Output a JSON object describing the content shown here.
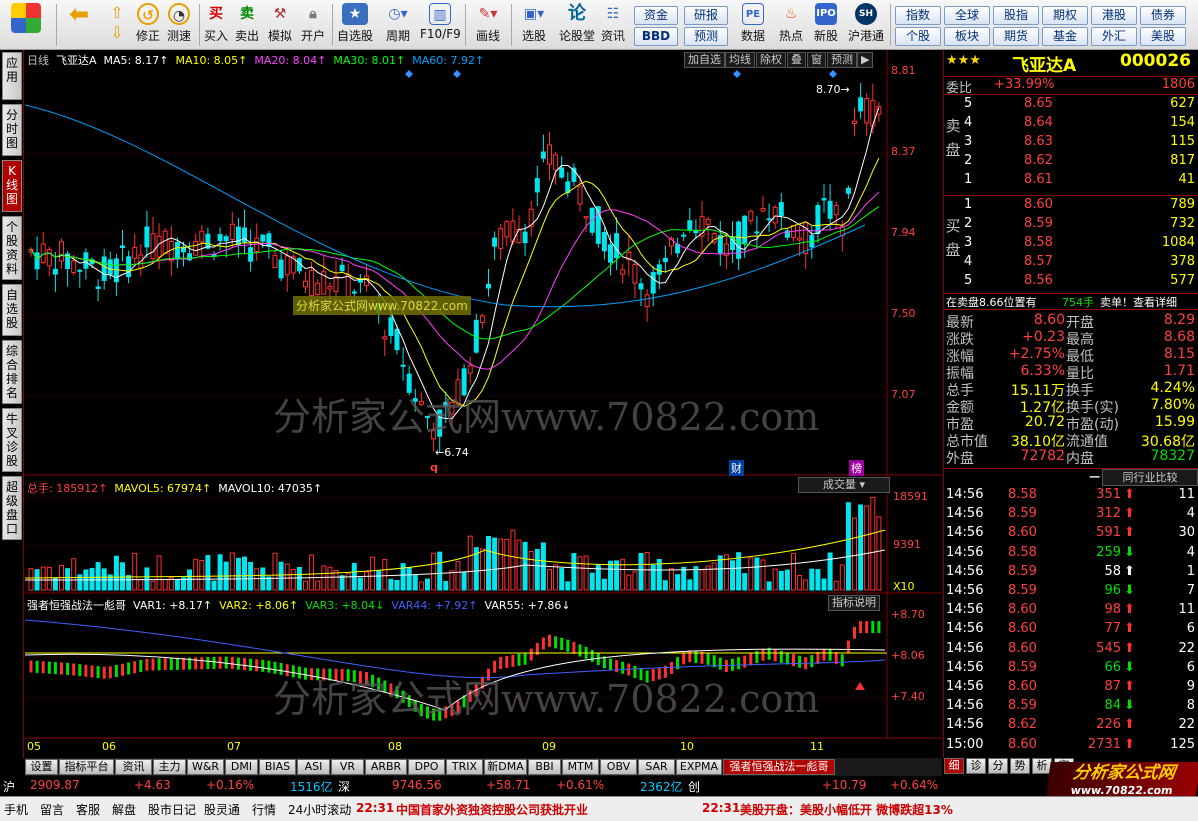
{
  "toolbar": {
    "buttons": [
      "修正",
      "测速",
      "买入",
      "卖出",
      "模拟",
      "开户",
      "自选股",
      "周期",
      "F10/F9",
      "画线",
      "选股",
      "论股堂",
      "资讯",
      "数据",
      "热点",
      "新股",
      "沪港通"
    ],
    "blue1": [
      "资金",
      "研报",
      "BBD",
      "预测"
    ],
    "blue2": [
      "指数",
      "全球",
      "股指",
      "期权",
      "港股",
      "债券",
      "个股",
      "板块",
      "期货",
      "基金",
      "外汇",
      "美股"
    ],
    "icon_glyphs": {
      "buy": "买",
      "sell": "卖",
      "lun": "论"
    }
  },
  "lefttabs": [
    "应用",
    "分时图",
    "K线图",
    "个股资料",
    "自选股",
    "综合排名",
    "牛叉诊股",
    "超级盘口"
  ],
  "kline": {
    "header": {
      "period": "日线",
      "name": "飞亚达A",
      "ma5": "MA5: 8.17↑",
      "ma10": "MA10: 8.05↑",
      "ma20": "MA20: 8.04↑",
      "ma30": "MA30: 8.01↑",
      "ma60": "MA60: 7.92↑"
    },
    "buttons": [
      "加自选",
      "均线",
      "除权",
      "叠",
      "窗",
      "预测",
      "▶"
    ],
    "yticks": [
      "8.81",
      "8.37",
      "7.94",
      "7.50",
      "7.07"
    ],
    "high_label": "8.70",
    "low_label": "6.74",
    "markers": [
      "q",
      "财",
      "榜"
    ],
    "watermark": "分析家公式网www.70822.com",
    "watermark_box": "分析家公式网www.70822.com"
  },
  "volume": {
    "header": {
      "total": "总手: 185912↑",
      "mavol5": "MAVOL5: 67974↑",
      "mavol10": "MAVOL10: 47035↑"
    },
    "selector": "成交量",
    "yticks": [
      "18591",
      "9391"
    ],
    "unit": "X10"
  },
  "indicator": {
    "header": {
      "name": "强者恒强战法一彪哥",
      "var1": "VAR1: +8.17↑",
      "var2": "VAR2: +8.06↑",
      "var3": "VAR3: +8.04↓",
      "var44": "VAR44: +7.92↑",
      "var55": "VAR55: +7.86↓"
    },
    "button": "指标说明",
    "yticks": [
      "+8.70",
      "+8.06",
      "+7.40"
    ]
  },
  "xaxis": [
    "05",
    "06",
    "07",
    "08",
    "09",
    "10",
    "11"
  ],
  "bottom_tabs": [
    "设置",
    "指标平台",
    "资讯",
    "主力",
    "W&R",
    "DMI",
    "BIAS",
    "ASI",
    "VR",
    "ARBR",
    "DPO",
    "TRIX",
    "新DMA",
    "BBI",
    "MTM",
    "OBV",
    "SAR",
    "EXPMA",
    "强者恒强战法一彪哥"
  ],
  "quote": {
    "stars": "★★★",
    "name": "飞亚达A",
    "code": "000026",
    "weibi_label": "委比",
    "weibi": "+33.99%",
    "weicha": "1806",
    "sell_label": "卖盘",
    "buy_label": "买盘",
    "sell": [
      {
        "n": "5",
        "p": "8.65",
        "v": "627"
      },
      {
        "n": "4",
        "p": "8.64",
        "v": "154"
      },
      {
        "n": "3",
        "p": "8.63",
        "v": "115"
      },
      {
        "n": "2",
        "p": "8.62",
        "v": "817"
      },
      {
        "n": "1",
        "p": "8.61",
        "v": "41"
      }
    ],
    "buy": [
      {
        "n": "1",
        "p": "8.60",
        "v": "789"
      },
      {
        "n": "2",
        "p": "8.59",
        "v": "732"
      },
      {
        "n": "3",
        "p": "8.58",
        "v": "1084"
      },
      {
        "n": "4",
        "p": "8.57",
        "v": "378"
      },
      {
        "n": "5",
        "p": "8.56",
        "v": "577"
      }
    ],
    "info": "在卖盘8.66位置有",
    "info_vol": "754手",
    "info_tail": "卖单！查看详细",
    "stats": [
      {
        "l1": "最新",
        "v1": "8.60",
        "l2": "开盘",
        "v2": "8.29"
      },
      {
        "l1": "涨跌",
        "v1": "+0.23",
        "l2": "最高",
        "v2": "8.68"
      },
      {
        "l1": "涨幅",
        "v1": "+2.75%",
        "l2": "最低",
        "v2": "8.15"
      },
      {
        "l1": "振幅",
        "v1": "6.33%",
        "l2": "量比",
        "v2": "1.71"
      },
      {
        "l1": "总手",
        "v1": "15.11万",
        "l2": "换手",
        "v2": "4.24%"
      },
      {
        "l1": "金额",
        "v1": "1.27亿",
        "l2": "换手(实)",
        "v2": "7.80%"
      },
      {
        "l1": "市盈",
        "v1": "20.72",
        "l2": "市盈(动)",
        "v2": "15.99"
      },
      {
        "l1": "总市值",
        "v1": "38.10亿",
        "l2": "流通值",
        "v2": "30.68亿"
      },
      {
        "l1": "外盘",
        "v1": "72782",
        "l2": "内盘",
        "v2": "78327"
      }
    ],
    "compare_btn": "同行业比较",
    "minus": "−",
    "ticks": [
      {
        "t": "14:56",
        "p": "8.58",
        "v": "351",
        "d": "up",
        "n": "11"
      },
      {
        "t": "14:56",
        "p": "8.59",
        "v": "312",
        "d": "up",
        "n": "4"
      },
      {
        "t": "14:56",
        "p": "8.60",
        "v": "591",
        "d": "up",
        "n": "30"
      },
      {
        "t": "14:56",
        "p": "8.58",
        "v": "259",
        "d": "down",
        "n": "4"
      },
      {
        "t": "14:56",
        "p": "8.59",
        "v": "58",
        "d": "upw",
        "n": "1"
      },
      {
        "t": "14:56",
        "p": "8.59",
        "v": "96",
        "d": "down",
        "n": "7"
      },
      {
        "t": "14:56",
        "p": "8.60",
        "v": "98",
        "d": "up",
        "n": "11"
      },
      {
        "t": "14:56",
        "p": "8.60",
        "v": "77",
        "d": "up",
        "n": "6"
      },
      {
        "t": "14:56",
        "p": "8.60",
        "v": "545",
        "d": "up",
        "n": "22"
      },
      {
        "t": "14:56",
        "p": "8.59",
        "v": "66",
        "d": "down",
        "n": "6"
      },
      {
        "t": "14:56",
        "p": "8.60",
        "v": "87",
        "d": "up",
        "n": "9"
      },
      {
        "t": "14:56",
        "p": "8.59",
        "v": "84",
        "d": "down",
        "n": "8"
      },
      {
        "t": "14:56",
        "p": "8.62",
        "v": "226",
        "d": "up",
        "n": "22"
      },
      {
        "t": "15:00",
        "p": "8.60",
        "v": "2731",
        "d": "up",
        "n": "125"
      }
    ],
    "tabs": [
      "细",
      "诊",
      "分",
      "势",
      "析",
      "家"
    ]
  },
  "ticker": {
    "sh_label": "沪",
    "sh": "2909.87",
    "sh_chg": "+4.63",
    "sh_pct": "+0.16%",
    "sh_amt": "1516亿",
    "sz_label": "深",
    "sz": "9746.56",
    "sz_chg": "+58.71",
    "sz_pct": "+0.61%",
    "sz_amt": "2362亿",
    "cy_label": "创",
    "cy_chg": "+10.79",
    "cy_pct": "+0.64%",
    "logo": "分析家公式网",
    "logo_url": "www.70822.com"
  },
  "status": {
    "items": [
      "手机",
      "留言",
      "客服",
      "解盘",
      "股市日记",
      "股灵通",
      "行情",
      "24小时滚动"
    ],
    "news1_time": "22:31",
    "news1": "中国首家外资独资控股公司获批开业",
    "news2_time": "22:31",
    "news2": "美股开盘：美股小幅低开 微博跌超13%"
  },
  "chart_data": {
    "type": "candlestick",
    "ylim": [
      6.6,
      8.9
    ],
    "note": "daily K-line with MA lines, volume bars and custom indicator",
    "visible_high": 8.7,
    "visible_low": 6.74
  },
  "colors": {
    "up": "#ff3030",
    "down": "#00e5ee",
    "ma5": "#ffffff",
    "ma10": "#ffff00",
    "ma20": "#ff40ff",
    "ma30": "#00ff00",
    "ma60": "#00a0ff"
  }
}
